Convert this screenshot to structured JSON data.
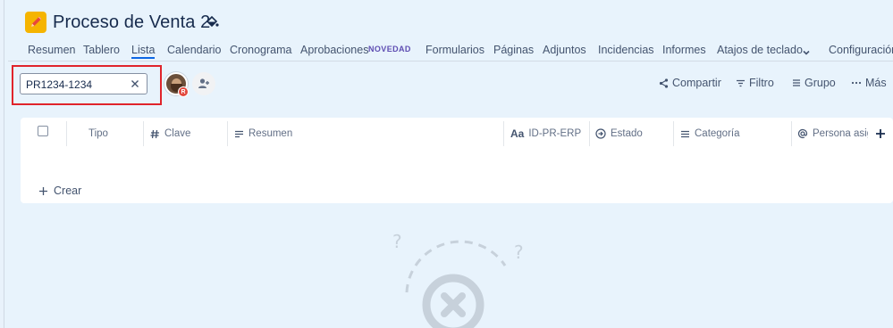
{
  "project": {
    "title": "Proceso de Venta 2",
    "icon": "pencil-icon",
    "accent": "#f5b400"
  },
  "tabs": [
    {
      "label": "Resumen"
    },
    {
      "label": "Tablero"
    },
    {
      "label": "Lista",
      "active": true
    },
    {
      "label": "Calendario"
    },
    {
      "label": "Cronograma"
    },
    {
      "label": "Aprobaciones"
    },
    {
      "label": "Formularios"
    },
    {
      "label": "Páginas"
    },
    {
      "label": "Adjuntos"
    },
    {
      "label": "Incidencias"
    },
    {
      "label": "Informes"
    },
    {
      "label": "Atajos de teclado"
    },
    {
      "label": "Configuración d"
    }
  ],
  "new_badge": "NOVEDAD",
  "toolbar": {
    "search_value": "PR1234-1234",
    "share_label": "Compartir",
    "filter_label": "Filtro",
    "group_label": "Grupo",
    "more_label": "Más",
    "avatar_badge": "R"
  },
  "table": {
    "columns": [
      {
        "label": "Tipo",
        "icon": ""
      },
      {
        "label": "Clave",
        "icon": "hash-icon"
      },
      {
        "label": "Resumen",
        "icon": "lines-icon"
      },
      {
        "label": "ID-PR-ERP",
        "icon": "text-field-icon",
        "icon_text": "Aa"
      },
      {
        "label": "Estado",
        "icon": "status-arrow-icon"
      },
      {
        "label": "Categoría",
        "icon": "list-icon"
      },
      {
        "label": "Persona asign",
        "icon": "at-icon"
      }
    ],
    "create_label": "Crear"
  },
  "colors": {
    "background": "#e8f3fc",
    "active_tab_underline": "#0c66e4",
    "highlight": "#e0242b",
    "badge": "#5e4db2"
  }
}
